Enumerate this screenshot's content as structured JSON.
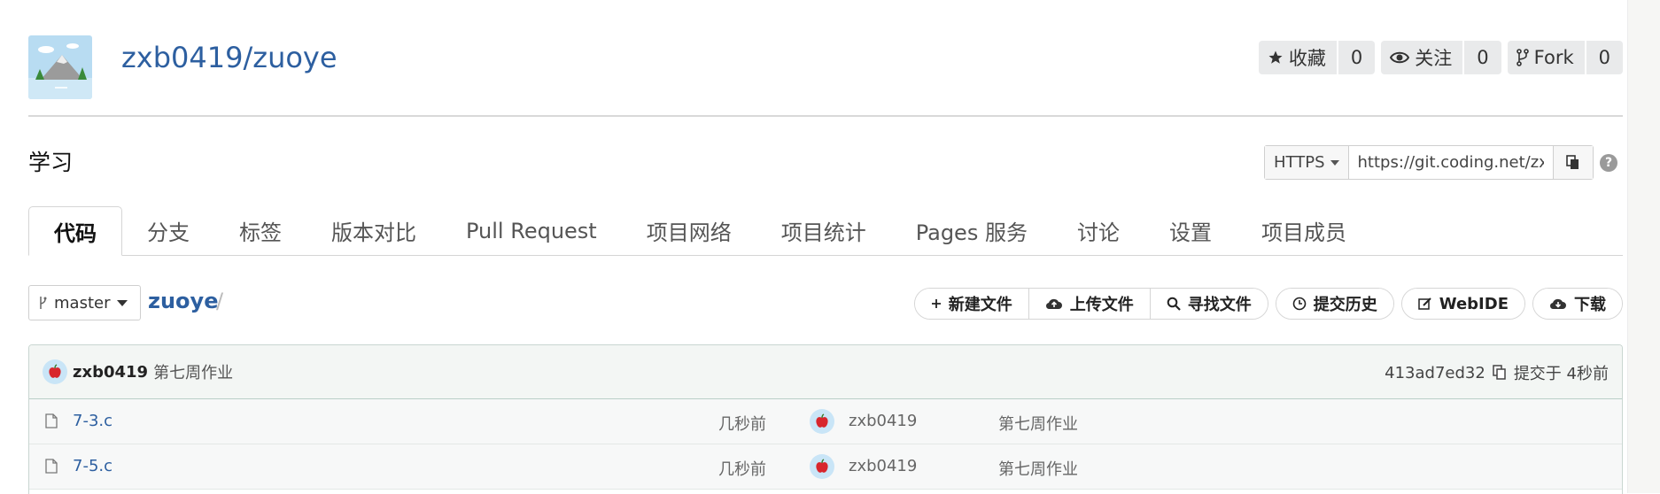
{
  "repo": {
    "full_name": "zxb0419/zuoye",
    "description": "学习"
  },
  "counters": [
    {
      "icon": "star-icon",
      "label": "收藏",
      "count": "0"
    },
    {
      "icon": "eye-icon",
      "label": "关注",
      "count": "0"
    },
    {
      "icon": "fork-icon",
      "label": "Fork",
      "count": "0"
    }
  ],
  "clone": {
    "protocol": "HTTPS",
    "url": "https://git.coding.net/zx"
  },
  "tabs": [
    "代码",
    "分支",
    "标签",
    "版本对比",
    "Pull Request",
    "项目网络",
    "项目统计",
    "Pages 服务",
    "讨论",
    "设置",
    "项目成员"
  ],
  "active_tab": "代码",
  "branch": {
    "name": "master",
    "path_root": "zuoye",
    "path_sep": "/"
  },
  "actions": {
    "new_file": "新建文件",
    "upload_file": "上传文件",
    "find_file": "寻找文件",
    "history": "提交历史",
    "webide": "WebIDE",
    "download": "下载"
  },
  "latest_commit": {
    "user": "zxb0419",
    "message": "第七周作业",
    "hash": "413ad7ed32",
    "time": "提交于 4秒前"
  },
  "files": [
    {
      "name": "7-3.c",
      "time": "几秒前",
      "user": "zxb0419",
      "message": "第七周作业"
    },
    {
      "name": "7-5.c",
      "time": "几秒前",
      "user": "zxb0419",
      "message": "第七周作业"
    }
  ],
  "colors": {
    "link": "#2d5fa0",
    "commit_bar": "#f3f6f4",
    "counter_bg": "#e9eaeb"
  }
}
